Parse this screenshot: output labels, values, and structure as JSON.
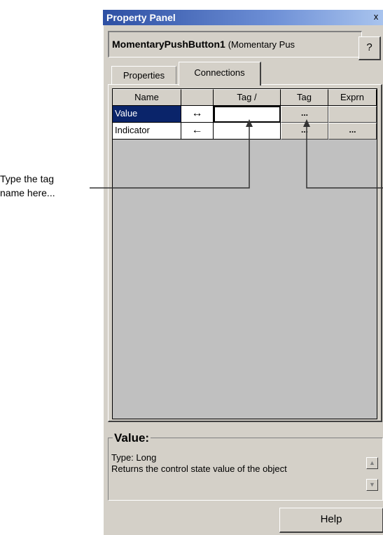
{
  "annotation": {
    "line1": "Type the tag",
    "line2": "name here..."
  },
  "window": {
    "title": "Property Panel",
    "close_glyph": "x"
  },
  "object": {
    "name": "MomentaryPushButton1",
    "type": "(Momentary Pus"
  },
  "help_question": "?",
  "tabs": [
    {
      "label": "Properties",
      "active": false
    },
    {
      "label": "Connections",
      "active": true
    }
  ],
  "grid": {
    "headers": [
      "Name",
      "",
      "Tag /",
      "Tag",
      "Exprn"
    ],
    "rows": [
      {
        "name": "Value",
        "direction": "↔",
        "tag": "",
        "tag_button": "...",
        "exprn_button": ""
      },
      {
        "name": "Indicator",
        "direction": "←",
        "tag": "",
        "tag_button": "...",
        "exprn_button": "..."
      }
    ]
  },
  "status": {
    "title": "Value:",
    "type_text": "Type: Long",
    "description": "Returns the control state value of the object"
  },
  "help_button": "Help",
  "colors": {
    "selection": "#0a246a",
    "face": "#d4d0c8",
    "titlebar": "#2d4fa3"
  },
  "icons": {
    "close": "close-icon",
    "scroll_up": "scroll-up-icon",
    "scroll_down": "scroll-down-icon"
  }
}
